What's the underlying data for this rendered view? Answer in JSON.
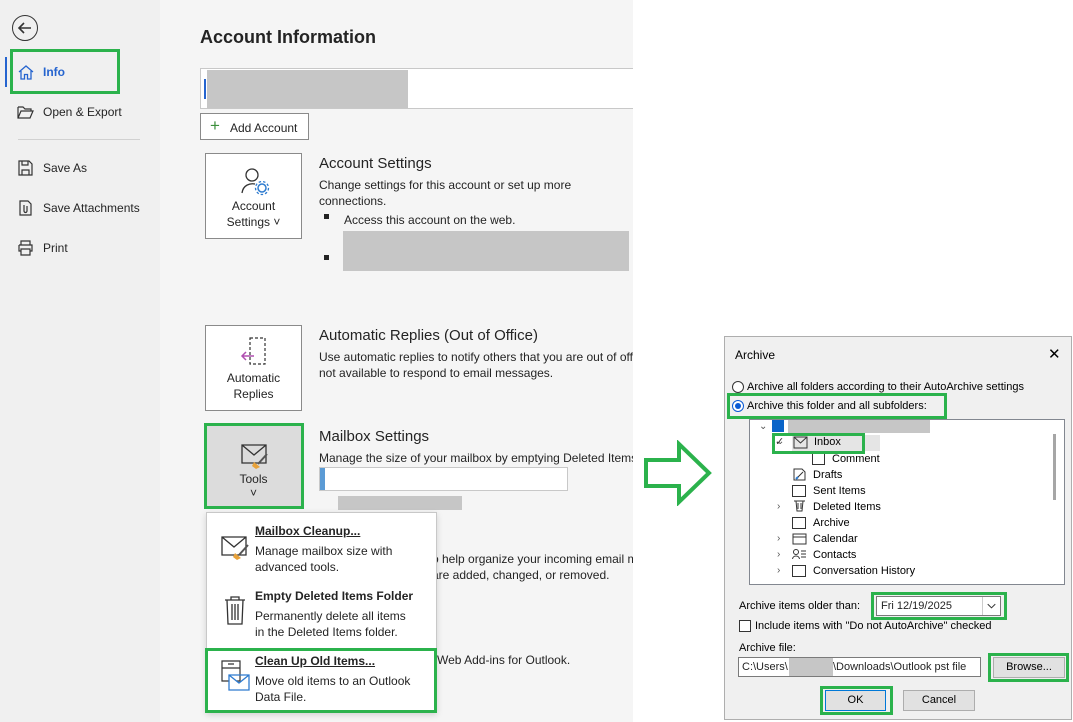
{
  "sidebar": {
    "items": [
      {
        "label": "Info",
        "icon": "home-icon"
      },
      {
        "label": "Open & Export",
        "icon": "folder-open-icon"
      },
      {
        "label": "Save As",
        "icon": "save-as-icon"
      },
      {
        "label": "Save Attachments",
        "icon": "attachment-icon"
      },
      {
        "label": "Print",
        "icon": "printer-icon"
      }
    ]
  },
  "main": {
    "title": "Account Information",
    "add_account_label": "Add Account",
    "account_settings": {
      "tile_line1": "Account",
      "tile_line2": "Settings ˅",
      "title": "Account Settings",
      "desc_line1": "Change settings for this account or set up more",
      "desc_line2": "connections.",
      "bullet1": "Access this account on the web."
    },
    "auto_replies": {
      "tile_line1": "Automatic",
      "tile_line2": "Replies",
      "title": "Automatic Replies (Out of Office)",
      "desc_line1": "Use automatic replies to notify others that you are out of off",
      "desc_line2": "not available to respond to email messages."
    },
    "mailbox": {
      "tile_line1": "Tools",
      "tile_line2": "˅",
      "title": "Mailbox Settings",
      "desc": "Manage the size of your mailbox by emptying Deleted Items",
      "fill_fraction": 0.02
    },
    "partial_lines": {
      "rules1": "o help organize your incoming email m",
      "rules2": "are added, changed, or removed.",
      "addins": "Web Add-ins for Outlook."
    }
  },
  "tools_menu": {
    "items": [
      {
        "title": "Mailbox Cleanup...",
        "desc1": "Manage mailbox size with",
        "desc2": "advanced tools."
      },
      {
        "title": "Empty Deleted Items Folder",
        "desc1": "Permanently delete all items",
        "desc2": "in the Deleted Items folder."
      },
      {
        "title": "Clean Up Old Items...",
        "desc1": "Move old items to an Outlook",
        "desc2": "Data File."
      }
    ]
  },
  "dialog": {
    "title": "Archive",
    "close": "✕",
    "radio_all": "Archive all folders according to their AutoArchive settings",
    "radio_this": "Archive this folder and all subfolders:",
    "folders": [
      {
        "label": "Inbox"
      },
      {
        "label": "Comment"
      },
      {
        "label": "Drafts"
      },
      {
        "label": "Sent Items"
      },
      {
        "label": "Deleted Items"
      },
      {
        "label": "Archive"
      },
      {
        "label": "Calendar"
      },
      {
        "label": "Contacts"
      },
      {
        "label": "Conversation History"
      }
    ],
    "older_than_label": "Archive items older than:",
    "older_than_value": "Fri 12/19/2025",
    "include_label": "Include items with \"Do not AutoArchive\" checked",
    "file_label": "Archive file:",
    "file_value_start": "C:\\Users\\",
    "file_value_end": "\\Downloads\\Outlook pst file",
    "browse": "Browse...",
    "ok": "OK",
    "cancel": "Cancel"
  },
  "colors": {
    "highlight": "#2bb24c",
    "accent": "#2564cf",
    "progress": "#5b9bd5"
  }
}
